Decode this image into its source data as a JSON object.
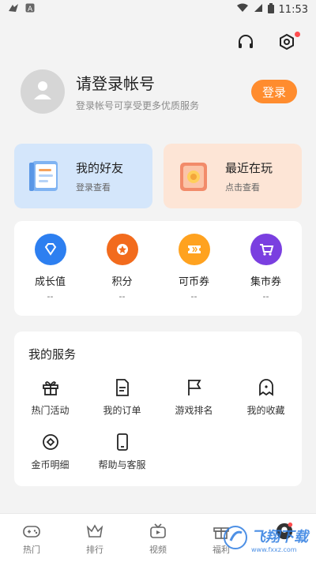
{
  "status_bar": {
    "time": "11:53"
  },
  "profile": {
    "title": "请登录帐号",
    "subtitle": "登录帐号可享受更多优质服务",
    "login_label": "登录"
  },
  "cards": [
    {
      "title": "我的好友",
      "subtitle": "登录查看"
    },
    {
      "title": "最近在玩",
      "subtitle": "点击查看"
    }
  ],
  "assets": [
    {
      "label": "成长值",
      "value": "--",
      "color": "#2d7ff0",
      "icon": "diamond-icon"
    },
    {
      "label": "积分",
      "value": "--",
      "color": "#f26b1d",
      "icon": "points-icon"
    },
    {
      "label": "可币券",
      "value": "--",
      "color": "#ffa21f",
      "icon": "coupon-icon"
    },
    {
      "label": "集市券",
      "value": "--",
      "color": "#7a3fe0",
      "icon": "cart-icon"
    }
  ],
  "services": {
    "title": "我的服务",
    "items": [
      {
        "label": "热门活动",
        "icon": "gift-icon"
      },
      {
        "label": "我的订单",
        "icon": "order-icon"
      },
      {
        "label": "游戏排名",
        "icon": "flag-icon"
      },
      {
        "label": "我的收藏",
        "icon": "ghost-icon"
      },
      {
        "label": "金币明细",
        "icon": "coin-icon"
      },
      {
        "label": "帮助与客服",
        "icon": "phone-icon"
      }
    ]
  },
  "tabbar": [
    {
      "label": "热门",
      "icon": "gamepad-icon"
    },
    {
      "label": "排行",
      "icon": "crown-icon"
    },
    {
      "label": "视频",
      "icon": "tv-icon"
    },
    {
      "label": "福利",
      "icon": "gift-icon"
    },
    {
      "label": "",
      "icon": "avatar-icon"
    }
  ],
  "watermark": {
    "text": "飞翔下载",
    "sub": "www.fxxz.com"
  },
  "colors": {
    "accent": "#ff8c2e",
    "blue_card": "#d4e6fb",
    "peach_card": "#fde5d6"
  }
}
